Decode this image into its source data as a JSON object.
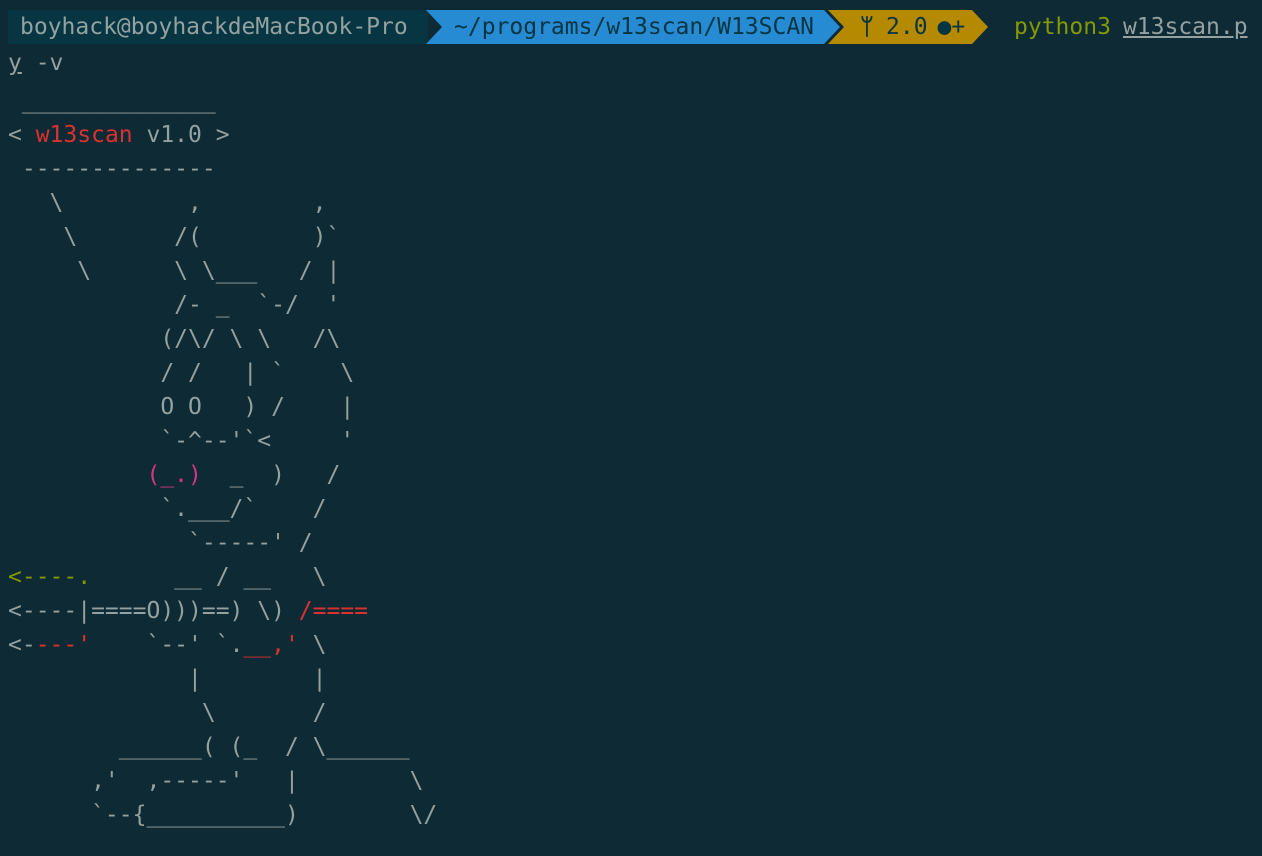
{
  "prompt": {
    "user_host": "boyhack@boyhackdeMacBook-Pro",
    "path": "~/programs/w13scan/W13SCAN",
    "git_version": "2.0",
    "git_status": "●+",
    "command": "python3",
    "argument": "w13scan.p",
    "continuation_first": "y",
    "continuation_rest": " -v"
  },
  "banner": {
    "title_open": "< ",
    "app_name": "w13scan",
    "version": " v1.0 >"
  },
  "ascii_lines": [
    " ______________",
    "",
    " --------------",
    "   \\         ,        ,",
    "    \\       /(        )`",
    "     \\      \\ \\___   / |",
    "            /- _  `-/  '",
    "           (/\\/ \\ \\   /\\",
    "           / /   | `    \\",
    "           O O   ) /    |",
    "           `-^--'`<     '",
    "",
    "           `.___/`    /",
    "             `-----' /",
    "",
    "",
    "",
    "             |        |",
    "              \\       /",
    "        ______( (_  / \\______",
    "      ,'  ,-----'   |        \\",
    "      `--{__________)        \\/"
  ],
  "colored": {
    "nose": "(_.)",
    "nose_rest": "  _  )   /",
    "arrow1": "<----.",
    "arrow1_rest": "      __ / __   \\",
    "arrow2": "<----|====O)))==) \\) ",
    "arrow2_red": "/====",
    "arrow3_a": "<-",
    "arrow3_b": "---'",
    "arrow3_c": "    `--' `.",
    "arrow3_d": "__,'",
    "arrow3_e": " \\"
  },
  "colors": {
    "background": "#0d2a35",
    "accent_red": "#dc322f",
    "accent_magenta": "#d33682",
    "accent_olive": "#859900",
    "path_blue": "#268bd2",
    "git_yellow": "#b58900"
  }
}
